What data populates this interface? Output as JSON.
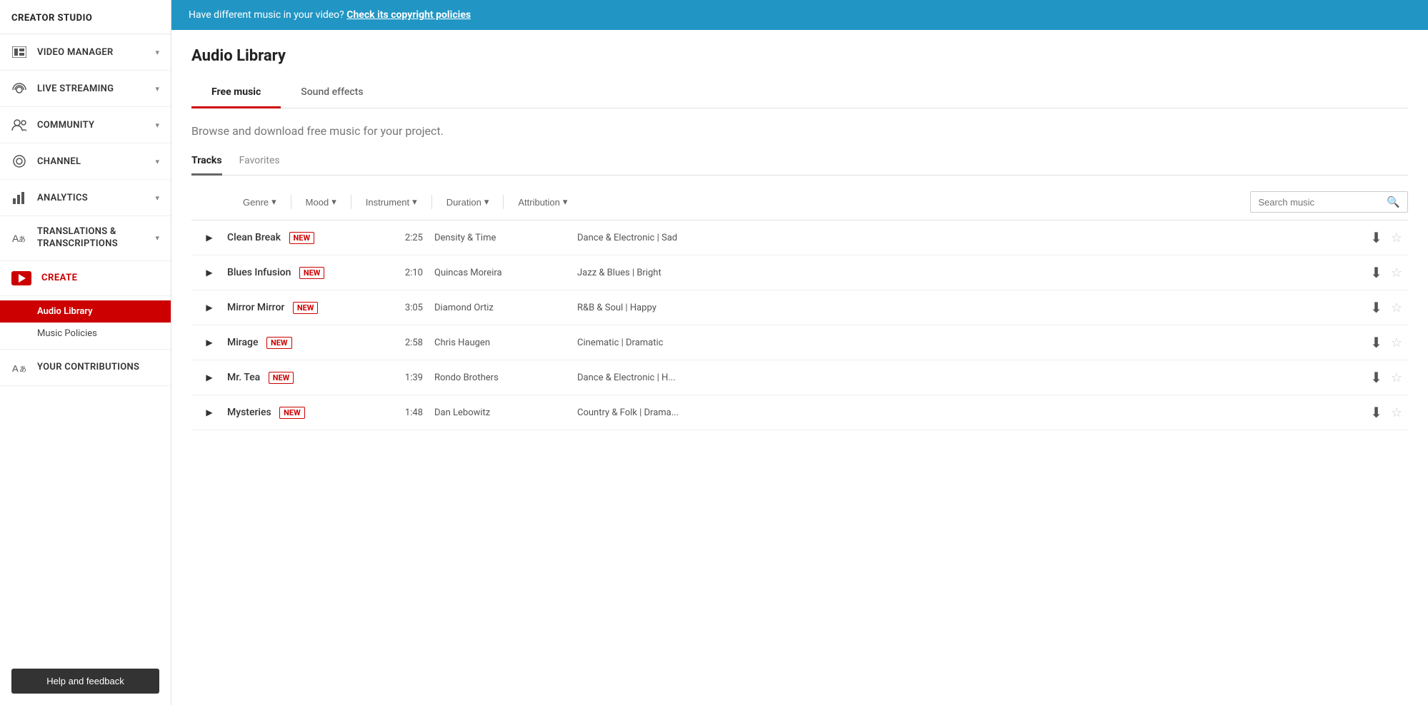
{
  "sidebar": {
    "title": "CREATOR STUDIO",
    "items": [
      {
        "id": "video-manager",
        "label": "VIDEO MANAGER",
        "icon": "video-manager",
        "hasChevron": true
      },
      {
        "id": "live-streaming",
        "label": "LIVE STREAMING",
        "icon": "live-streaming",
        "hasChevron": true
      },
      {
        "id": "community",
        "label": "COMMUNITY",
        "icon": "community",
        "hasChevron": true
      },
      {
        "id": "channel",
        "label": "CHANNEL",
        "icon": "channel",
        "hasChevron": true
      },
      {
        "id": "analytics",
        "label": "ANALYTICS",
        "icon": "analytics",
        "hasChevron": true
      },
      {
        "id": "translations",
        "label": "TRANSLATIONS & TRANSCRIPTIONS",
        "icon": "translations",
        "hasChevron": true
      }
    ],
    "create_label": "CREATE",
    "sub_items": [
      {
        "id": "audio-library",
        "label": "Audio Library",
        "active": true
      },
      {
        "id": "music-policies",
        "label": "Music Policies",
        "active": false
      }
    ],
    "your_contributions_label": "YOUR CONTRIBUTIONS",
    "help_label": "Help and feedback"
  },
  "banner": {
    "text": "Have different music in your video?",
    "link_text": "Check its copyright policies"
  },
  "page": {
    "title": "Audio Library",
    "tabs": [
      {
        "id": "free-music",
        "label": "Free music",
        "active": true
      },
      {
        "id": "sound-effects",
        "label": "Sound effects",
        "active": false
      }
    ],
    "subtitle": "Browse and download free music for your project.",
    "sub_tabs": [
      {
        "id": "tracks",
        "label": "Tracks",
        "active": true
      },
      {
        "id": "favorites",
        "label": "Favorites",
        "active": false
      }
    ],
    "filters": [
      {
        "id": "genre",
        "label": "Genre"
      },
      {
        "id": "mood",
        "label": "Mood"
      },
      {
        "id": "instrument",
        "label": "Instrument"
      },
      {
        "id": "duration",
        "label": "Duration"
      },
      {
        "id": "attribution",
        "label": "Attribution"
      }
    ],
    "search_placeholder": "Search music",
    "tracks": [
      {
        "name": "Clean Break",
        "is_new": true,
        "duration": "2:25",
        "artist": "Density & Time",
        "genre": "Dance & Electronic | Sad"
      },
      {
        "name": "Blues Infusion",
        "is_new": true,
        "duration": "2:10",
        "artist": "Quincas Moreira",
        "genre": "Jazz & Blues | Bright"
      },
      {
        "name": "Mirror Mirror",
        "is_new": true,
        "duration": "3:05",
        "artist": "Diamond Ortiz",
        "genre": "R&B & Soul | Happy"
      },
      {
        "name": "Mirage",
        "is_new": true,
        "duration": "2:58",
        "artist": "Chris Haugen",
        "genre": "Cinematic | Dramatic"
      },
      {
        "name": "Mr. Tea",
        "is_new": true,
        "duration": "1:39",
        "artist": "Rondo Brothers",
        "genre": "Dance & Electronic | H..."
      },
      {
        "name": "Mysteries",
        "is_new": true,
        "duration": "1:48",
        "artist": "Dan Lebowitz",
        "genre": "Country & Folk | Drama..."
      }
    ],
    "new_badge": "NEW"
  }
}
